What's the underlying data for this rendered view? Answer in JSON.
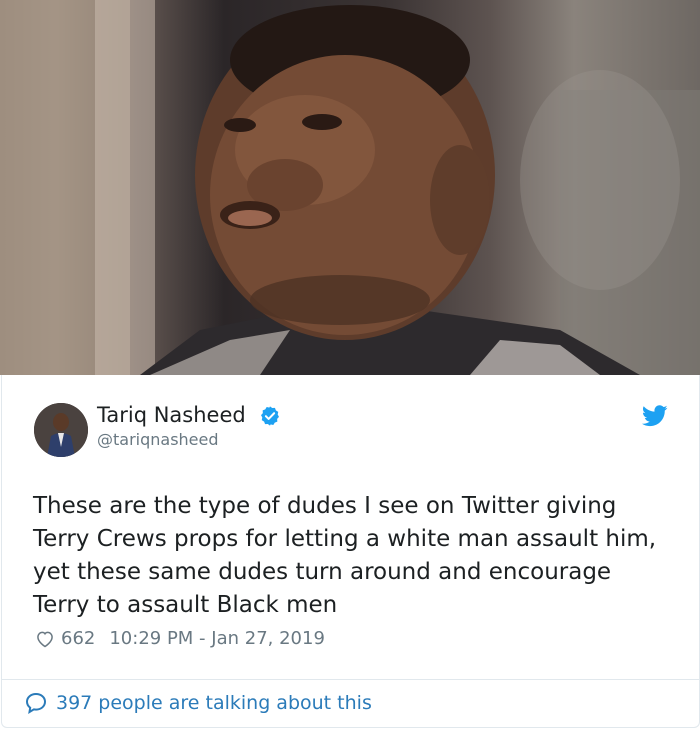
{
  "tweet": {
    "display_name": "Tariq Nasheed",
    "handle": "@tariqnasheed",
    "text": "These are the type of dudes I see on Twitter giving Terry Crews props for letting a white man assault him, yet these same dudes turn around and encourage Terry to assault Black men",
    "likes": "662",
    "timestamp": "10:29 PM - Jan 27, 2019",
    "talking": "397 people are talking about this"
  },
  "icons": {
    "verified": "verified-badge-icon",
    "bird": "twitter-bird-icon",
    "heart": "heart-icon",
    "bubble": "comment-bubble-icon"
  },
  "colors": {
    "accent": "#1da1f2",
    "link": "#2b7bb9",
    "text": "#1c2022",
    "muted": "#697882"
  }
}
